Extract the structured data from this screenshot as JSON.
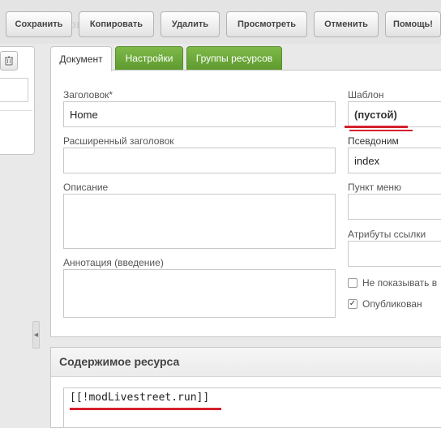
{
  "toolbar": {
    "buttons": [
      "Сохранить",
      "Копировать",
      "Удалить",
      "Просмотреть",
      "Отменить",
      "Помощь!"
    ]
  },
  "tabs": [
    "Документ",
    "Настройки",
    "Группы ресурсов"
  ],
  "form": {
    "title_label": "Заголовок*",
    "title_value": "Home",
    "longtitle_label": "Расширенный заголовок",
    "longtitle_value": "",
    "description_label": "Описание",
    "description_value": "",
    "introtext_label": "Аннотация (введение)",
    "introtext_value": "",
    "template_label": "Шаблон",
    "template_value": "(пустой)",
    "alias_label": "Псевдоним",
    "alias_value": "index",
    "menutitle_label": "Пункт меню",
    "menutitle_value": "",
    "link_attrs_label": "Атрибуты ссылки",
    "link_attrs_value": "",
    "hidemenu_label": "Не показывать в",
    "hidemenu_checked": false,
    "published_label": "Опубликован",
    "published_checked": true
  },
  "content": {
    "title": "Содержимое ресурса",
    "value": "[[!modLivestreet.run]]"
  },
  "colors": {
    "accent_green": "#6aa83a",
    "highlight_red": "#d3212d"
  },
  "icons": {
    "left_tool": "trash-icon",
    "collapse": "chevron-left-icon"
  }
}
